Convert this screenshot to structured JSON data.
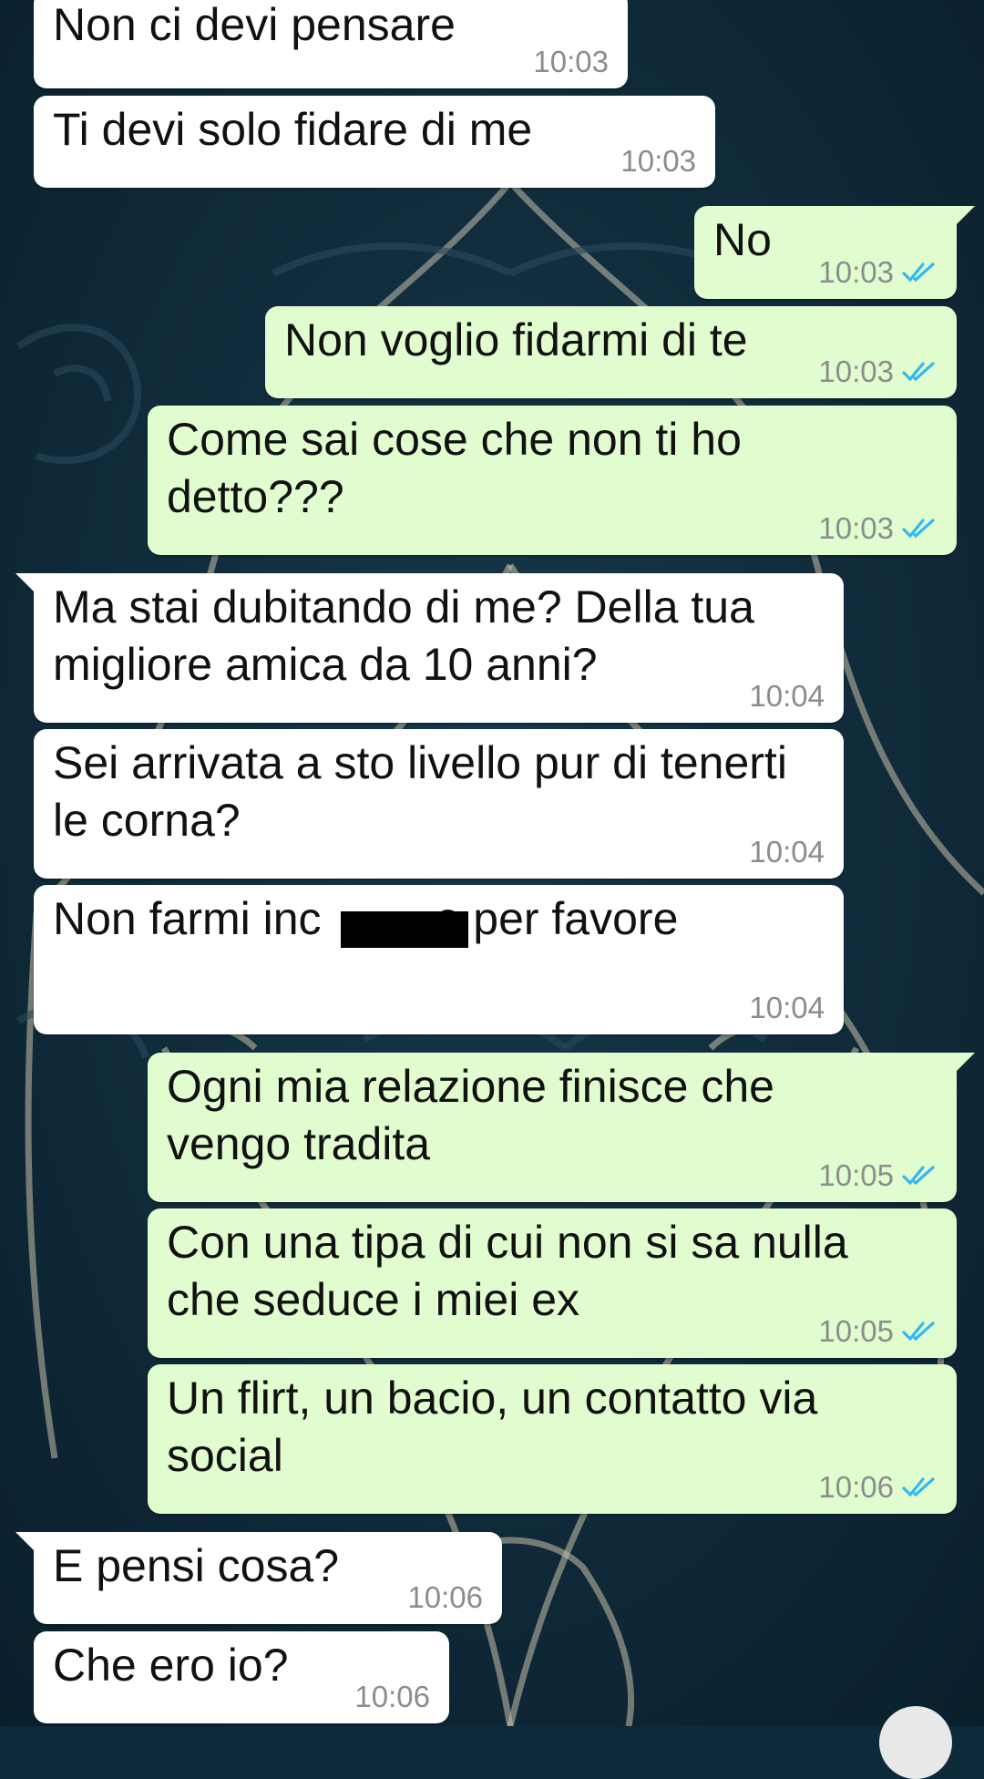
{
  "colors": {
    "wallpaper": "#0d2a3a",
    "incoming_bubble": "#ffffff",
    "outgoing_bubble": "#e1fdcf",
    "read_ticks": "#34b7f1",
    "timestamp": "#8c8c8c"
  },
  "icons": {
    "read_receipt": "double-check-icon",
    "scroll_button": "scroll-to-bottom-button"
  },
  "messages": [
    {
      "direction": "incoming",
      "text": "Non ci devi pensare",
      "time": "10:03"
    },
    {
      "direction": "incoming",
      "text": "Ti devi solo fidare di me",
      "time": "10:03"
    },
    {
      "direction": "outgoing",
      "text": "No",
      "time": "10:03",
      "status": "read"
    },
    {
      "direction": "outgoing",
      "text": "Non voglio fidarmi di te",
      "time": "10:03",
      "status": "read"
    },
    {
      "direction": "outgoing",
      "text": "Come sai cose che non ti ho\ndetto???",
      "time": "10:03",
      "status": "read"
    },
    {
      "direction": "incoming",
      "text": "Ma stai dubitando di me? Della tua\nmigliore amica da 10 anni?",
      "time": "10:04"
    },
    {
      "direction": "incoming",
      "text": "Sei arrivata a sto livello pur di tenerti\nle corna?",
      "time": "10:04"
    },
    {
      "direction": "incoming",
      "text": "Non farmi inc         e per favore",
      "time": "10:04",
      "redacted": true
    },
    {
      "direction": "outgoing",
      "text": "Ogni mia relazione finisce che\nvengo tradita",
      "time": "10:05",
      "status": "read"
    },
    {
      "direction": "outgoing",
      "text": "Con una tipa di cui non si sa nulla\nche seduce i miei ex",
      "time": "10:05",
      "status": "read"
    },
    {
      "direction": "outgoing",
      "text": "Un flirt, un bacio, un contatto via\nsocial",
      "time": "10:06",
      "status": "read"
    },
    {
      "direction": "incoming",
      "text": "E pensi cosa?",
      "time": "10:06"
    },
    {
      "direction": "incoming",
      "text": "Che ero io?",
      "time": "10:06"
    }
  ]
}
